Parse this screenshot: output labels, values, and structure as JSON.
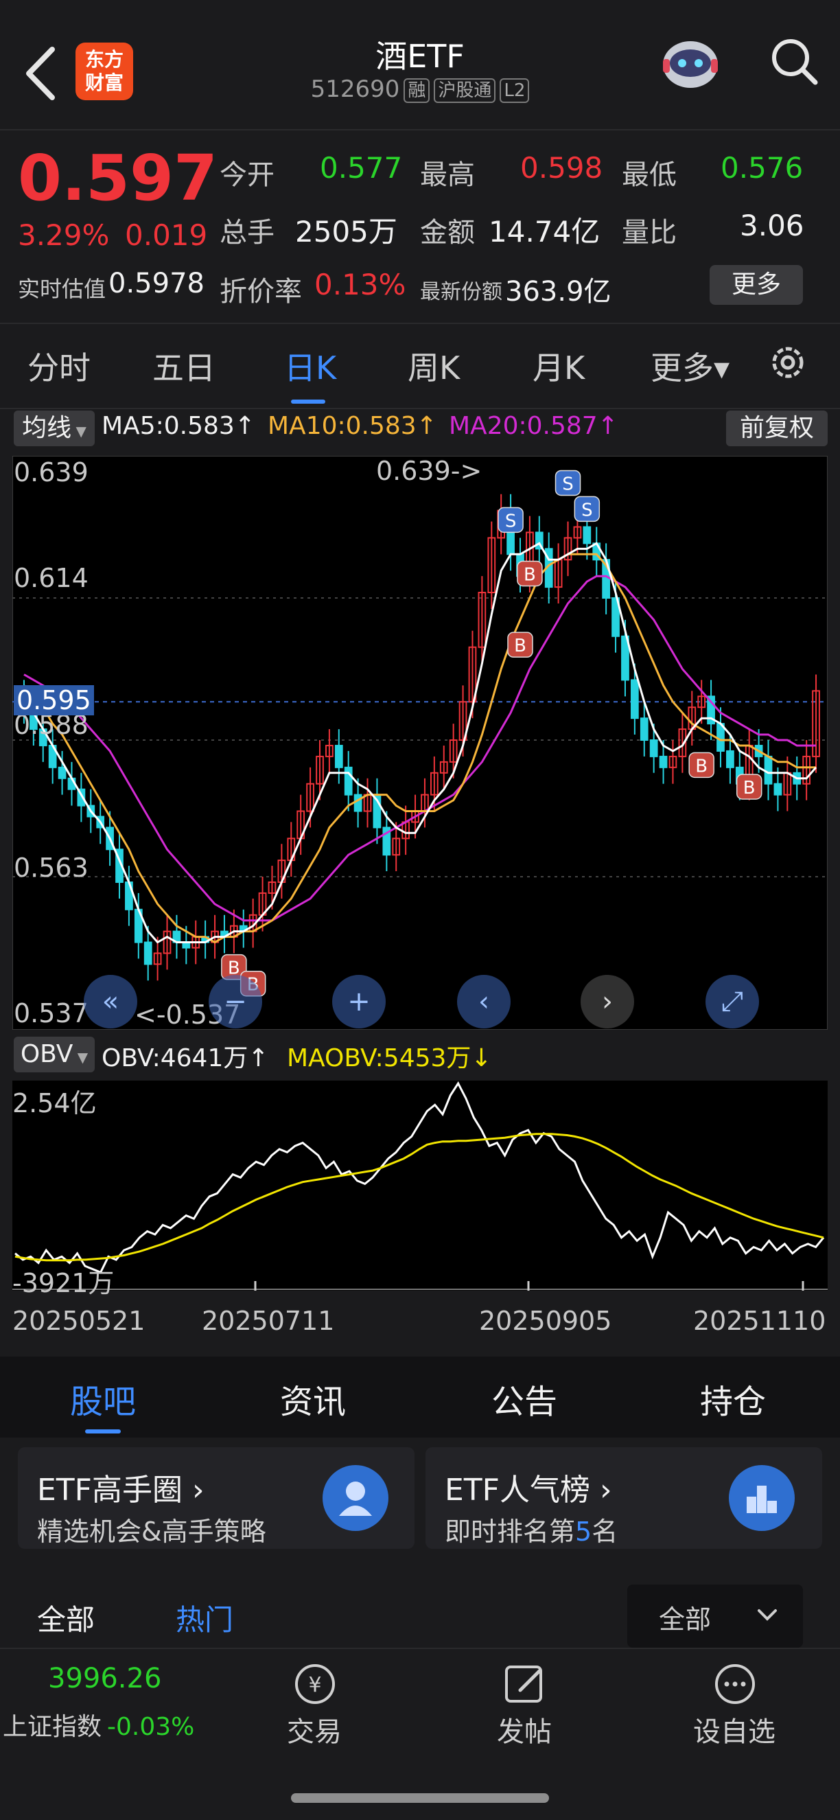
{
  "header": {
    "logo_line1": "东方",
    "logo_line2": "财富",
    "title": "酒ETF",
    "code": "512690",
    "tags": [
      "融",
      "沪股通",
      "L2"
    ]
  },
  "quote": {
    "price": "0.597",
    "change_pct": "3.29%",
    "change_abs": "0.019",
    "open_label": "今开",
    "open": "0.577",
    "high_label": "最高",
    "high": "0.598",
    "low_label": "最低",
    "low": "0.576",
    "volume_label": "总手",
    "volume": "2505万",
    "amount_label": "金额",
    "amount": "14.74亿",
    "ratio_label": "量比",
    "ratio": "3.06",
    "iopv_label": "实时估值",
    "iopv": "0.5978",
    "premium_label": "折价率",
    "premium": "0.13%",
    "shares_label": "最新份额",
    "shares": "363.9亿",
    "more_label": "更多"
  },
  "period_tabs": [
    "分时",
    "五日",
    "日K",
    "周K",
    "月K",
    "更多▾"
  ],
  "active_period": "日K",
  "ma_legend": {
    "selector": "均线",
    "ma5": "MA5:0.583↑",
    "ma10": "MA10:0.583↑",
    "ma20": "MA20:0.587↑",
    "adjust": "前复权"
  },
  "obv_legend": {
    "selector": "OBV",
    "obv": "OBV:4641万↑",
    "maobv": "MAOBV:5453万↓"
  },
  "chart_data": [
    {
      "type": "candlestick",
      "ylim": [
        0.537,
        0.639
      ],
      "y_ticks": [
        "0.639",
        "0.614",
        "0.588",
        "0.563",
        "0.537"
      ],
      "current_line_label": "0.595",
      "max_annotation": "0.639->",
      "min_annotation": "<-0.537",
      "colors": {
        "up": "#f0343a",
        "down": "#27d3e0",
        "ma5": "#ffffff",
        "ma10": "#f6b53a",
        "ma20": "#d32bd3"
      },
      "close": [
        0.594,
        0.59,
        0.587,
        0.583,
        0.581,
        0.579,
        0.576,
        0.574,
        0.572,
        0.568,
        0.562,
        0.557,
        0.551,
        0.547,
        0.549,
        0.553,
        0.551,
        0.55,
        0.552,
        0.551,
        0.553,
        0.552,
        0.554,
        0.553,
        0.556,
        0.56,
        0.562,
        0.566,
        0.57,
        0.575,
        0.58,
        0.585,
        0.587,
        0.583,
        0.578,
        0.575,
        0.578,
        0.572,
        0.567,
        0.57,
        0.573,
        0.575,
        0.578,
        0.582,
        0.584,
        0.588,
        0.595,
        0.605,
        0.615,
        0.625,
        0.63,
        0.622,
        0.618,
        0.626,
        0.623,
        0.616,
        0.621,
        0.625,
        0.627,
        0.624,
        0.621,
        0.614,
        0.607,
        0.599,
        0.592,
        0.588,
        0.585,
        0.583,
        0.585,
        0.59,
        0.594,
        0.596,
        0.591,
        0.586,
        0.583,
        0.58,
        0.587,
        0.585,
        0.58,
        0.578,
        0.582,
        0.58,
        0.585,
        0.597
      ],
      "ma5": [
        0.596,
        0.593,
        0.59,
        0.587,
        0.584,
        0.581,
        0.578,
        0.575,
        0.573,
        0.57,
        0.566,
        0.562,
        0.557,
        0.553,
        0.551,
        0.552,
        0.551,
        0.551,
        0.551,
        0.551,
        0.552,
        0.552,
        0.553,
        0.553,
        0.554,
        0.556,
        0.558,
        0.562,
        0.566,
        0.57,
        0.574,
        0.578,
        0.582,
        0.582,
        0.582,
        0.58,
        0.579,
        0.577,
        0.574,
        0.572,
        0.571,
        0.571,
        0.574,
        0.577,
        0.579,
        0.582,
        0.587,
        0.594,
        0.602,
        0.611,
        0.619,
        0.622,
        0.622,
        0.623,
        0.624,
        0.621,
        0.621,
        0.622,
        0.623,
        0.623,
        0.624,
        0.621,
        0.615,
        0.608,
        0.601,
        0.595,
        0.59,
        0.587,
        0.586,
        0.587,
        0.59,
        0.592,
        0.592,
        0.591,
        0.589,
        0.586,
        0.585,
        0.583,
        0.582,
        0.582,
        0.582,
        0.581,
        0.581,
        0.583
      ],
      "ma10": [
        0.598,
        0.596,
        0.594,
        0.591,
        0.589,
        0.586,
        0.583,
        0.58,
        0.577,
        0.574,
        0.571,
        0.568,
        0.564,
        0.561,
        0.558,
        0.556,
        0.554,
        0.553,
        0.552,
        0.552,
        0.551,
        0.552,
        0.552,
        0.553,
        0.553,
        0.554,
        0.555,
        0.557,
        0.559,
        0.562,
        0.565,
        0.568,
        0.572,
        0.574,
        0.576,
        0.577,
        0.578,
        0.578,
        0.578,
        0.576,
        0.575,
        0.575,
        0.575,
        0.575,
        0.576,
        0.577,
        0.58,
        0.584,
        0.589,
        0.595,
        0.601,
        0.606,
        0.61,
        0.614,
        0.618,
        0.62,
        0.621,
        0.622,
        0.622,
        0.622,
        0.622,
        0.62,
        0.617,
        0.614,
        0.61,
        0.606,
        0.602,
        0.598,
        0.595,
        0.593,
        0.591,
        0.59,
        0.589,
        0.588,
        0.588,
        0.587,
        0.587,
        0.586,
        0.585,
        0.584,
        0.584,
        0.583,
        0.583,
        0.583
      ],
      "ma20": [
        0.6,
        0.599,
        0.598,
        0.597,
        0.595,
        0.594,
        0.592,
        0.59,
        0.588,
        0.586,
        0.583,
        0.58,
        0.577,
        0.574,
        0.571,
        0.568,
        0.566,
        0.564,
        0.562,
        0.56,
        0.558,
        0.557,
        0.556,
        0.555,
        0.555,
        0.555,
        0.555,
        0.556,
        0.557,
        0.558,
        0.559,
        0.561,
        0.563,
        0.565,
        0.567,
        0.568,
        0.569,
        0.57,
        0.571,
        0.572,
        0.573,
        0.574,
        0.575,
        0.576,
        0.577,
        0.578,
        0.58,
        0.582,
        0.584,
        0.587,
        0.59,
        0.593,
        0.597,
        0.601,
        0.604,
        0.607,
        0.61,
        0.613,
        0.615,
        0.617,
        0.618,
        0.618,
        0.617,
        0.616,
        0.614,
        0.612,
        0.61,
        0.607,
        0.604,
        0.601,
        0.599,
        0.597,
        0.595,
        0.593,
        0.592,
        0.591,
        0.59,
        0.589,
        0.589,
        0.588,
        0.588,
        0.587,
        0.587,
        0.587
      ],
      "signals": [
        {
          "label": "B",
          "index": 22
        },
        {
          "label": "B",
          "index": 24
        },
        {
          "label": "S",
          "index": 51
        },
        {
          "label": "S",
          "index": 57
        },
        {
          "label": "S",
          "index": 59
        },
        {
          "label": "B",
          "index": 52
        },
        {
          "label": "B",
          "index": 53
        },
        {
          "label": "B",
          "index": 71
        },
        {
          "label": "B",
          "index": 76
        }
      ]
    },
    {
      "type": "line",
      "ylim": [
        -39210000,
        254000000
      ],
      "y_ticks": [
        "2.54亿",
        "-3921万"
      ],
      "x_ticks": [
        "20250521",
        "20250711",
        "20250905",
        "20251110"
      ],
      "colors": {
        "obv": "#ffffff",
        "maobv": "#f2e500"
      },
      "series": [
        {
          "name": "OBV",
          "values": [
            -0.15,
            -0.25,
            -0.2,
            -0.3,
            -0.1,
            -0.25,
            -0.2,
            -0.3,
            -0.15,
            -0.35,
            -0.4,
            -0.45,
            -0.2,
            -0.25,
            -0.1,
            -0.05,
            0.1,
            0.2,
            0.15,
            0.3,
            0.25,
            0.35,
            0.45,
            0.4,
            0.6,
            0.75,
            0.8,
            0.95,
            1.1,
            1.05,
            1.2,
            1.3,
            1.25,
            1.4,
            1.5,
            1.45,
            1.55,
            1.6,
            1.5,
            1.4,
            1.2,
            1.3,
            1.1,
            1.15,
            1.0,
            0.95,
            1.05,
            1.2,
            1.35,
            1.45,
            1.6,
            1.7,
            1.9,
            2.1,
            2.2,
            2.05,
            2.35,
            2.54,
            2.3,
            2.0,
            1.8,
            1.55,
            1.6,
            1.4,
            1.65,
            1.75,
            1.8,
            1.6,
            1.75,
            1.7,
            1.5,
            1.4,
            1.3,
            1.0,
            0.8,
            0.6,
            0.4,
            0.3,
            0.1,
            0.2,
            0.05,
            0.15,
            -0.2,
            0.1,
            0.5,
            0.4,
            0.3,
            0.05,
            0.2,
            0.1,
            0.25,
            0.0,
            0.1,
            0.05,
            -0.15,
            -0.05,
            -0.1,
            0.05,
            -0.1,
            0.0,
            -0.15,
            -0.05,
            0.0,
            -0.05,
            0.1
          ]
        },
        {
          "name": "MAOBV",
          "values": [
            -0.2,
            -0.22,
            -0.24,
            -0.25,
            -0.26,
            -0.26,
            -0.26,
            -0.26,
            -0.25,
            -0.25,
            -0.24,
            -0.23,
            -0.22,
            -0.2,
            -0.18,
            -0.15,
            -0.12,
            -0.08,
            -0.04,
            0.0,
            0.05,
            0.1,
            0.15,
            0.2,
            0.25,
            0.32,
            0.38,
            0.45,
            0.52,
            0.58,
            0.64,
            0.7,
            0.75,
            0.8,
            0.85,
            0.9,
            0.94,
            0.98,
            1.0,
            1.02,
            1.04,
            1.06,
            1.08,
            1.1,
            1.12,
            1.14,
            1.16,
            1.2,
            1.25,
            1.3,
            1.35,
            1.42,
            1.5,
            1.57,
            1.6,
            1.62,
            1.62,
            1.63,
            1.63,
            1.64,
            1.65,
            1.66,
            1.67,
            1.68,
            1.7,
            1.72,
            1.73,
            1.74,
            1.74,
            1.74,
            1.73,
            1.72,
            1.7,
            1.67,
            1.63,
            1.58,
            1.52,
            1.45,
            1.38,
            1.3,
            1.22,
            1.15,
            1.08,
            1.02,
            0.97,
            0.92,
            0.86,
            0.8,
            0.75,
            0.7,
            0.65,
            0.6,
            0.55,
            0.5,
            0.45,
            0.4,
            0.36,
            0.32,
            0.28,
            0.25,
            0.22,
            0.19,
            0.16,
            0.13,
            0.1
          ]
        }
      ]
    }
  ],
  "news_tabs": [
    "股吧",
    "资讯",
    "公告",
    "持仓"
  ],
  "active_news_tab": "股吧",
  "cards": [
    {
      "title": "ETF高手圈 ›",
      "subtitle": "精选机会&高手策略"
    },
    {
      "title": "ETF人气榜 ›",
      "subtitle_prefix": "即时排名第",
      "subtitle_rank": "5",
      "subtitle_suffix": "名"
    }
  ],
  "filter": {
    "all": "全部",
    "hot": "热门",
    "dropdown": "全部"
  },
  "bottom_bar": {
    "index_value": "3996.26",
    "index_name": "上证指数",
    "index_change": "-0.03%",
    "trade": "交易",
    "post": "发帖",
    "watch": "设自选"
  }
}
